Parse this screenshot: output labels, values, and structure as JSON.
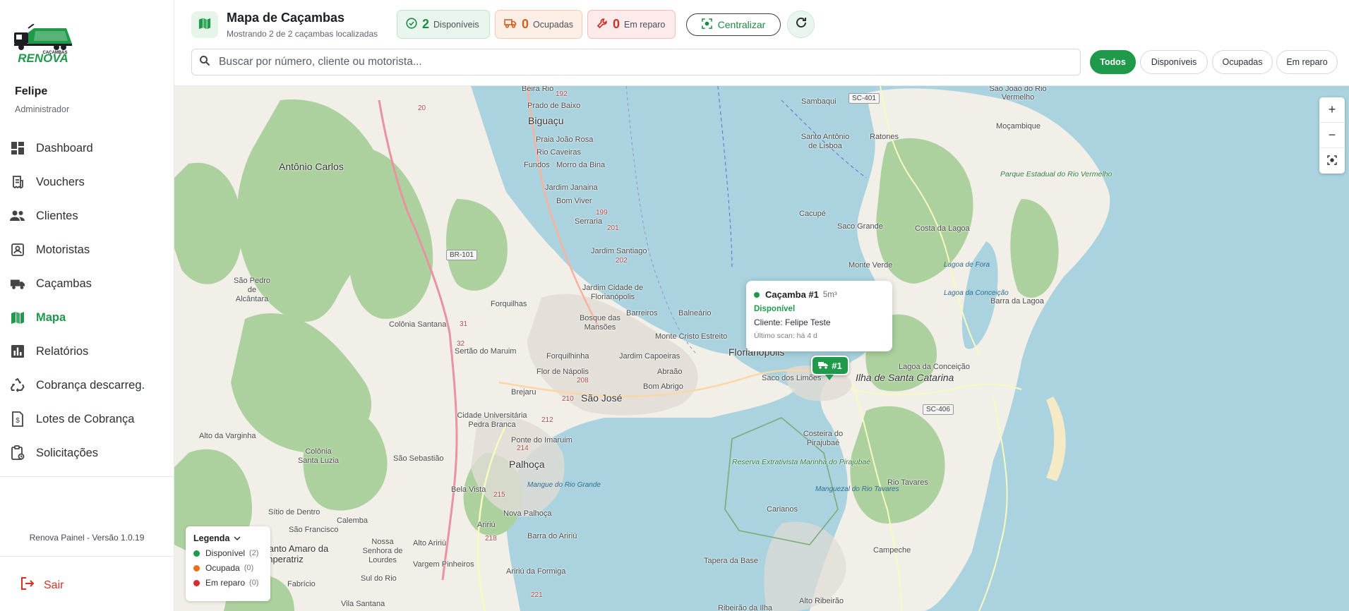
{
  "app": {
    "logo_text": "RENOVA",
    "logo_subtext": "CAÇAMBAS",
    "brand_color": "#1f9a4a"
  },
  "user": {
    "name": "Felipe",
    "role": "Administrador"
  },
  "sidebar": {
    "items": [
      {
        "label": "Dashboard",
        "icon": "dashboard-icon"
      },
      {
        "label": "Vouchers",
        "icon": "receipt-icon"
      },
      {
        "label": "Clientes",
        "icon": "people-icon"
      },
      {
        "label": "Motoristas",
        "icon": "badge-icon"
      },
      {
        "label": "Caçambas",
        "icon": "truck-icon"
      },
      {
        "label": "Mapa",
        "icon": "map-icon",
        "active": true
      },
      {
        "label": "Relatórios",
        "icon": "bar-chart-icon"
      },
      {
        "label": "Cobrança descarreg.",
        "icon": "recycle-icon"
      },
      {
        "label": "Lotes de Cobrança",
        "icon": "invoice-icon"
      },
      {
        "label": "Solicitações",
        "icon": "clipboard-icon"
      }
    ],
    "version": "Renova Painel - Versão 1.0.19",
    "logout": "Sair"
  },
  "header": {
    "title": "Mapa de Caçambas",
    "subtitle": "Mostrando 2 de 2 caçambas localizadas",
    "stats": {
      "available": {
        "count": "2",
        "label": "Disponíveis",
        "color": "#1f8a42"
      },
      "occupied": {
        "count": "0",
        "label": "Ocupadas",
        "color": "#d35f1d"
      },
      "repair": {
        "count": "0",
        "label": "Em reparo",
        "color": "#c8322b"
      }
    },
    "center_button": "Centralizar"
  },
  "search": {
    "placeholder": "Buscar por número, cliente ou motorista..."
  },
  "filters": {
    "all": "Todos",
    "available": "Disponíveis",
    "occupied": "Ocupadas",
    "repair": "Em reparo",
    "active": "Todos"
  },
  "map": {
    "zoom_in": "+",
    "zoom_out": "−",
    "labels": {
      "florianopolis": "Florianópolis",
      "sao_jose": "São José",
      "palhoca": "Palhoça",
      "biguacu": "Biguaçu",
      "island": "Ilha de Santa Catarina",
      "antonio_carlos": "Antônio Carlos",
      "sao_pedro": "São Pedro de Alcântara",
      "colonia_santana": "Colônia Santana",
      "forquilhas": "Forquilhas",
      "serraria": "Serraria",
      "jardim_santiago": "Jardim Santiago",
      "jardim_cidade": "Jardim Cidade de Florianópolis",
      "bosque_mansoes": "Bosque das Mansões",
      "barreiros": "Barreiros",
      "balneario": "Balneário",
      "estreito": "Estreito",
      "monte_cristo": "Monte Cristo",
      "jardim_capoeiras": "Jardim Capoeiras",
      "forquilhinha": "Forquilhinha",
      "flor_napolis": "Flor de Nápolis",
      "abraao": "Abraão",
      "bom_abrigo": "Bom Abrigo",
      "sertao_maruim": "Sertão do Maruim",
      "brejaru": "Brejaru",
      "cidade_universitaria": "Cidade Universitária Pedra Branca",
      "ponte_imaruim": "Ponte do Imaruim",
      "sao_sebastiao": "São Sebastião",
      "bela_vista": "Bela Vista",
      "nova_palhoca": "Nova Palhoça",
      "barra_aririu": "Barra do Aririú",
      "aririu": "Aririú",
      "alto_aririu": "Alto Aririú",
      "nossa_senhora": "Nossa Senhora de Lourdes",
      "vargem_pinheiros": "Vargem Pinheiros",
      "santo_amaro": "Santo Amaro da Imperatriz",
      "sul_do_rio": "Sul do Rio",
      "aririu_formiga": "Aririú da Formiga",
      "vila_santana": "Vila Santana",
      "fabricio": "Fabrício",
      "sao_francisco": "São Francisco",
      "calemba": "Calemba",
      "sitio_dentro": "Sítio de Dentro",
      "colonia_santa_luzia": "Colônia Santa Luzia",
      "alto_varginha": "Alto da Varginha",
      "saco_limoes": "Saco dos Limões",
      "costeira": "Costeira do Pirajubaé",
      "carianos": "Carianos",
      "tapera": "Tapera da Base",
      "ribeirao": "Ribeirão da Ilha",
      "alto_ribeirao": "Alto Ribeirão",
      "campeche": "Campeche",
      "rio_tavares": "Rio Tavares",
      "lagoa_conceicao": "Lagoa da Conceição",
      "costa_lagoa": "Costa da Lagoa",
      "monte_verde": "Monte Verde",
      "saco_grande": "Saco Grande",
      "cacupe": "Cacupé",
      "santo_antonio": "Santo Antônio de Lisboa",
      "ratones": "Ratones",
      "sambaqui": "Sambaqui",
      "mocambique": "Moçambique",
      "sao_joao_rio_vermelho": "São João do Rio Vermelho",
      "barra_lagoa": "Barra da Lagoa",
      "beira_rio": "Beira Rio",
      "prado_baixo": "Prado de Baixo",
      "praia_joao_rosa": "Praia João Rosa",
      "rio_caveiras": "Rio Caveiras",
      "fundos": "Fundos",
      "morro_bina": "Morro da Bina",
      "jardim_janaina": "Jardim Janaina",
      "bom_viver": "Bom Viver",
      "parque_rio_vermelho": "Parque Estadual do Rio Vermelho",
      "reserva": "Reserva Extrativista Marinha do Pirajubaé",
      "lagoa_fora": "Lagoa de Fora",
      "lagoa_conceicao_water": "Lagoa da Conceição",
      "manguezal_rio_tavares": "Manguezal do Rio Tavares",
      "mangue_rio_grande": "Mangue do Rio Grande"
    },
    "shields": {
      "br101": "BR-101",
      "sc401": "SC-401",
      "sc406": "SC-406",
      "r192": "192",
      "r20": "20",
      "r199": "199",
      "r201": "201",
      "r202": "202",
      "r208": "208",
      "r210": "210",
      "r212": "212",
      "r214": "214",
      "r215": "215",
      "r218": "218",
      "r221": "221",
      "r31": "31",
      "r32": "32"
    },
    "popup": {
      "name": "Caçamba #1",
      "size": "5m³",
      "status": "Disponível",
      "client": "Cliente: Felipe Teste",
      "scan": "Último scan: há 4 d"
    },
    "marker_label": "#1",
    "legend": {
      "title": "Legenda",
      "items": [
        {
          "label": "Disponível",
          "count": "(2)",
          "color": "#1f9a4a"
        },
        {
          "label": "Ocupada",
          "count": "(0)",
          "color": "#ef6c1a"
        },
        {
          "label": "Em reparo",
          "count": "(0)",
          "color": "#d32f2f"
        }
      ]
    }
  }
}
